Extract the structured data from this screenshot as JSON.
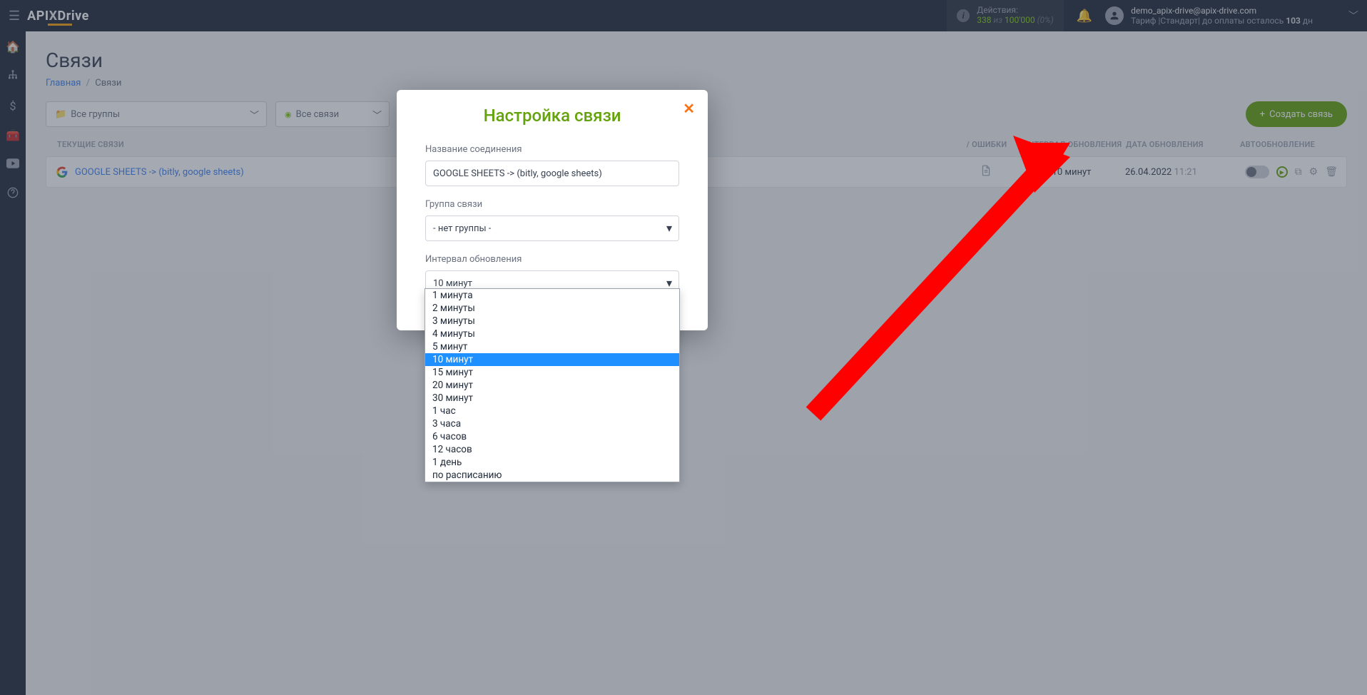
{
  "header": {
    "logo_api": "API",
    "logo_x": "X",
    "logo_drive": "Drive",
    "actions_label": "Действия:",
    "actions_used": "338",
    "actions_of": "из",
    "actions_total": "100'000",
    "actions_pct": "(0%)",
    "user_email": "demo_apix-drive@apix-drive.com",
    "tariff_prefix": "Тариф |Стандарт| до оплаты осталось ",
    "tariff_days": "103",
    "tariff_suffix": " дн"
  },
  "page": {
    "title": "Связи",
    "breadcrumb_home": "Главная",
    "breadcrumb_current": "Связи"
  },
  "filters": {
    "groups": "Все группы",
    "connections": "Все связи",
    "create_btn": "Создать связь"
  },
  "table": {
    "header_current": "ТЕКУЩИЕ СВЯЗИ",
    "header_log": "/ ОШИБКИ",
    "header_interval": "ИНТЕРВАЛ ОБНОВЛЕНИЯ",
    "header_date": "ДАТА ОБНОВЛЕНИЯ",
    "header_auto": "АВТООБНОВЛЕНИЕ",
    "row_name": "GOOGLE SHEETS -> (bitly, google sheets)",
    "row_interval": "10 минут",
    "row_date": "26.04.2022",
    "row_time": "11:21"
  },
  "modal": {
    "title": "Настройка связи",
    "name_label": "Название соединения",
    "name_value": "GOOGLE SHEETS -> (bitly, google sheets)",
    "group_label": "Группа связи",
    "group_value": "- нет группы -",
    "interval_label": "Интервал обновления",
    "interval_value": "10 минут",
    "options": [
      "1 минута",
      "2 минуты",
      "3 минуты",
      "4 минуты",
      "5 минут",
      "10 минут",
      "15 минут",
      "20 минут",
      "30 минут",
      "1 час",
      "3 часа",
      "6 часов",
      "12 часов",
      "1 день",
      "по расписанию"
    ],
    "selected_option": "10 минут"
  }
}
